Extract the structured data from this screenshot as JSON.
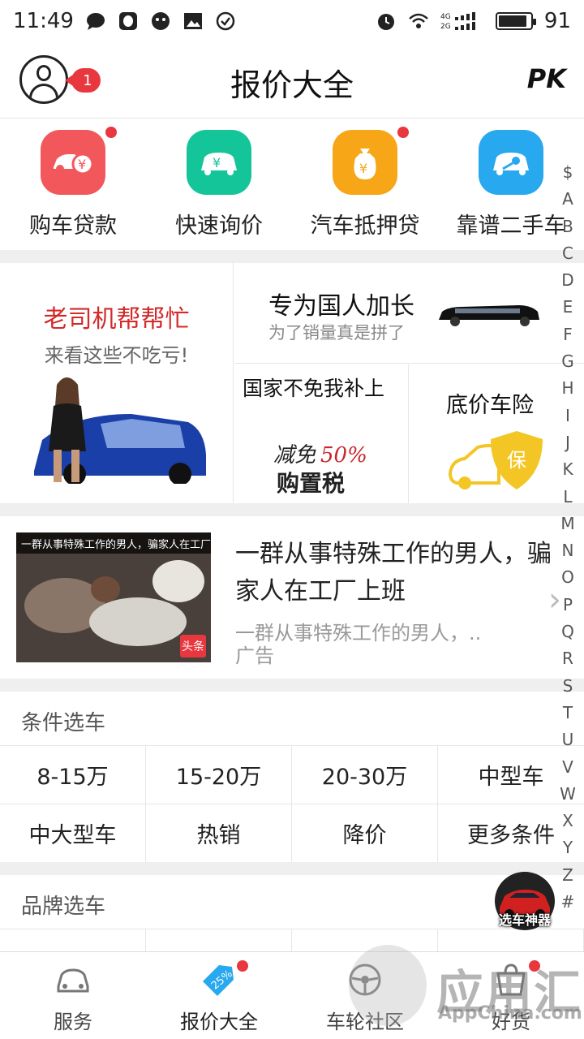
{
  "status_bar": {
    "time": "11:49",
    "battery": "91",
    "network": "4G 2G",
    "battery_level_pct": 91
  },
  "header": {
    "title": "报价大全",
    "badge": "1",
    "pk_label": "PK"
  },
  "services": [
    {
      "label": "购车贷款",
      "icon": "loan-car-icon",
      "color": "#f2585b",
      "dot": true
    },
    {
      "label": "快速询价",
      "icon": "price-inquiry-icon",
      "color": "#14c59a",
      "dot": false
    },
    {
      "label": "汽车抵押贷",
      "icon": "money-bag-icon",
      "color": "#f6a617",
      "dot": true
    },
    {
      "label": "靠谱二手车",
      "icon": "key-car-icon",
      "color": "#28a8ee",
      "dot": false
    }
  ],
  "promo": {
    "left_title": "老司机帮帮忙",
    "left_subtitle": "来看这些不吃亏!",
    "top_right_title": "专为国人加长",
    "top_right_subtitle": "为了销量真是拼了",
    "bottom_left_title": "国家不免我补上",
    "bottom_left_art": "减免50% 购置税",
    "bottom_right_title": "底价车险",
    "shield_char": "保"
  },
  "ad": {
    "thumb_caption": "一群从事特殊工作的男人，骗家人在工厂上班",
    "thumb_tag": "头条",
    "title": "一群从事特殊工作的男人，骗家人在工厂上班",
    "description": "一群从事特殊工作的男人，..",
    "label": "广告"
  },
  "conditions": {
    "title": "条件选车",
    "items": [
      "8-15万",
      "15-20万",
      "20-30万",
      "中型车",
      "中大型车",
      "热销",
      "降价",
      "更多条件"
    ]
  },
  "brands": {
    "title": "品牌选车"
  },
  "index_letters": [
    "$",
    "A",
    "B",
    "C",
    "D",
    "E",
    "F",
    "G",
    "H",
    "I",
    "J",
    "K",
    "L",
    "M",
    "N",
    "O",
    "P",
    "Q",
    "R",
    "S",
    "T",
    "U",
    "V",
    "W",
    "X",
    "Y",
    "Z",
    "#"
  ],
  "float_button": {
    "label": "选车神器"
  },
  "tabs": [
    {
      "label": "服务",
      "icon": "car-service-icon",
      "active": false,
      "dot": false
    },
    {
      "label": "报价大全",
      "icon": "discount-tag-icon",
      "active": true,
      "dot": true
    },
    {
      "label": "车轮社区",
      "icon": "steering-wheel-icon",
      "active": false,
      "dot": false
    },
    {
      "label": "好货",
      "icon": "shopping-icon",
      "active": false,
      "dot": true
    }
  ],
  "watermark": {
    "brand": "应用汇",
    "domain": "AppChina.com"
  }
}
